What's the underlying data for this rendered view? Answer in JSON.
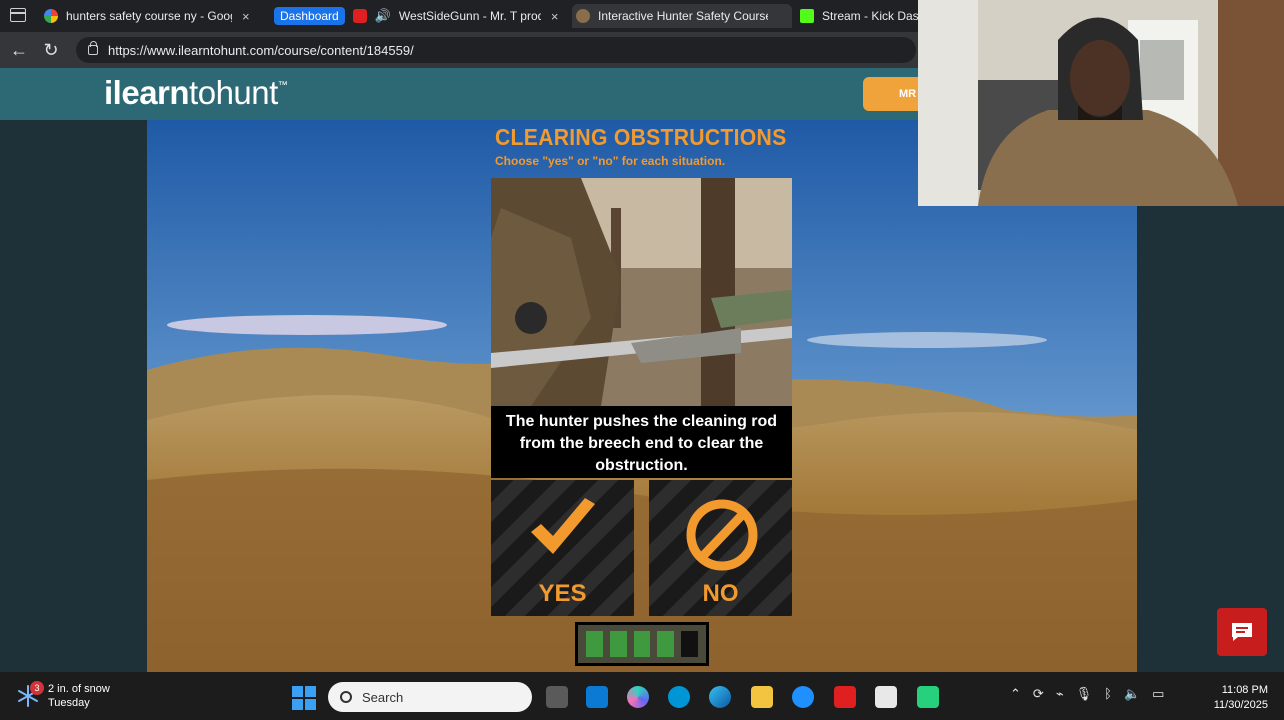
{
  "browser": {
    "tabs": [
      {
        "label": "hunters safety course ny - Google",
        "active": false
      },
      {
        "label": "WestSideGunn - Mr. T prod",
        "badge": "Dashboard",
        "active": false
      },
      {
        "label": "Interactive Hunter Safety Course",
        "active": true
      },
      {
        "label": "Stream - Kick Dash",
        "active": false
      }
    ],
    "close_glyph": "×",
    "url": "https://www.ilearntohunt.com/course/content/184559/"
  },
  "site": {
    "logo_bold": "ilearn",
    "logo_light": "tohunt",
    "logo_tm": "™",
    "header_button": "MR",
    "accent_color": "#f29a2e",
    "header_color": "#2d6975"
  },
  "lesson": {
    "title": "CLEARING OBSTRUCTIONS",
    "subtitle": "Choose \"yes\" or \"no\" for each situation.",
    "caption": "The hunter pushes the cleaning rod from the breech end to clear the obstruction.",
    "choices": {
      "yes": "YES",
      "no": "NO"
    },
    "progress": {
      "completed": 4,
      "total": 5
    }
  },
  "taskbar": {
    "weather_count": "3",
    "weather_line1": "2 in. of snow",
    "weather_line2": "Tuesday",
    "search_placeholder": "Search",
    "time": "11:08 PM",
    "date": "11/30/2025"
  }
}
